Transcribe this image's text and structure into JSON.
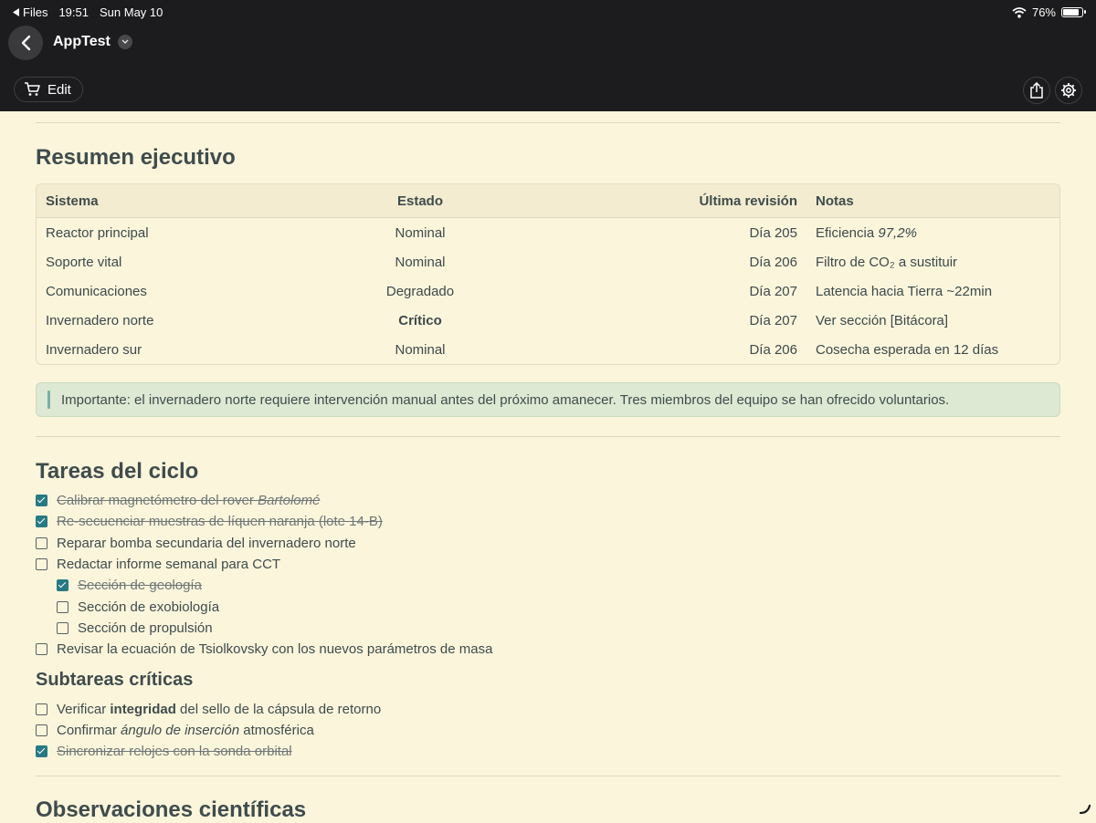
{
  "status": {
    "app_back": "Files",
    "time": "19:51",
    "date": "Sun May 10",
    "battery": "76%",
    "battery_level": 0.76
  },
  "nav": {
    "title": "AppTest",
    "edit_label": "Edit"
  },
  "summary": {
    "heading": "Resumen ejecutivo",
    "columns": [
      "Sistema",
      "Estado",
      "Última revisión",
      "Notas"
    ],
    "rows": [
      {
        "sistema": "Reactor principal",
        "estado": "Nominal",
        "revision": "Día 205",
        "notas_pre": "Eficiencia ",
        "notas_em": "97,2%"
      },
      {
        "sistema": "Soporte vital",
        "estado": "Nominal",
        "revision": "Día 206",
        "notas": "Filtro de CO₂ a sustituir"
      },
      {
        "sistema": "Comunicaciones",
        "estado": "Degradado",
        "revision": "Día 207",
        "notas": "Latencia hacia Tierra ~22min"
      },
      {
        "sistema": "Invernadero norte",
        "estado": "Crítico",
        "revision": "Día 207",
        "notas": "Ver sección [Bitácora]"
      },
      {
        "sistema": "Invernadero sur",
        "estado": "Nominal",
        "revision": "Día 206",
        "notas": "Cosecha esperada en 12 días"
      }
    ],
    "callout": "Importante: el invernadero norte requiere intervención manual antes del próximo amanecer. Tres miembros del equipo se han ofrecido voluntarios."
  },
  "tasks": {
    "heading": "Tareas del ciclo",
    "items": [
      {
        "pre": "Calibrar magnetómetro del rover ",
        "em": "Bartolomé",
        "checked": true
      },
      {
        "text": "Re-secuenciar muestras de líquen naranja (lote 14-B)",
        "checked": true
      },
      {
        "text": "Reparar bomba secundaria del invernadero norte",
        "checked": false
      },
      {
        "text": "Redactar informe semanal para CCT",
        "checked": false
      },
      {
        "text": "Sección de geología",
        "checked": true,
        "indent": true
      },
      {
        "text": "Sección de exobiología",
        "checked": false,
        "indent": true
      },
      {
        "text": "Sección de propulsión",
        "checked": false,
        "indent": true
      },
      {
        "text": "Revisar la ecuación de Tsiolkovsky con los nuevos parámetros de masa",
        "checked": false
      }
    ]
  },
  "subtasks": {
    "heading": "Subtareas críticas",
    "items": [
      {
        "pre": "Verificar ",
        "strong": "integridad",
        "post": " del sello de la cápsula de retorno",
        "checked": false
      },
      {
        "pre": "Confirmar ",
        "em": "ángulo de inserción",
        "post": " atmosférica",
        "checked": false
      },
      {
        "text": "Sincronizar relojes con la sonda orbital",
        "checked": true
      }
    ]
  },
  "observations": {
    "heading": "Observaciones científicas"
  },
  "colors": {
    "topbar": "#1c1c1e",
    "page_bg": "#fbf5dc",
    "accent": "#277a84",
    "callout_bg": "#dde9d3"
  }
}
